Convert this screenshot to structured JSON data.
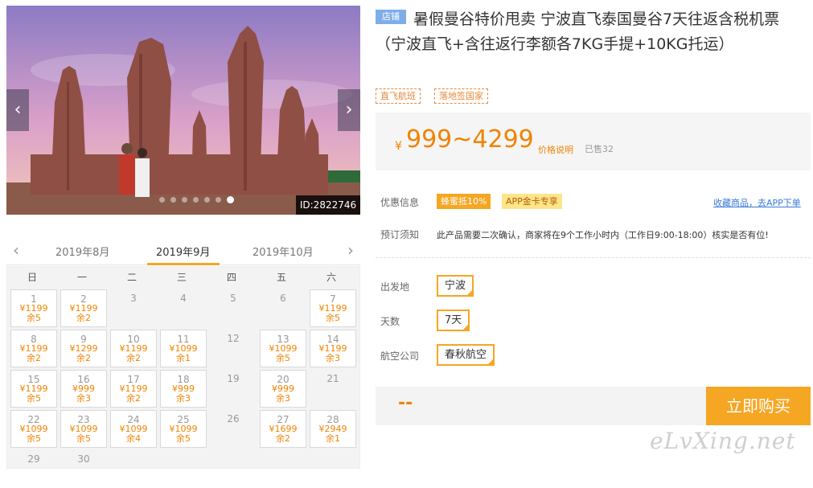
{
  "gallery": {
    "prev_icon": "‹",
    "next_icon": "›",
    "id_label": "ID:2822746"
  },
  "calendar": {
    "prev_month": "2019年8月",
    "current_month": "2019年9月",
    "next_month": "2019年10月",
    "weekdays": [
      "日",
      "一",
      "二",
      "三",
      "四",
      "五",
      "六"
    ],
    "days": [
      {
        "day": "1",
        "price": "¥1199",
        "stock": "余5"
      },
      {
        "day": "2",
        "price": "¥1199",
        "stock": "余2"
      },
      {
        "day": "3",
        "price": "",
        "stock": ""
      },
      {
        "day": "4",
        "price": "",
        "stock": ""
      },
      {
        "day": "5",
        "price": "",
        "stock": ""
      },
      {
        "day": "6",
        "price": "",
        "stock": ""
      },
      {
        "day": "7",
        "price": "¥1199",
        "stock": "余5"
      },
      {
        "day": "8",
        "price": "¥1199",
        "stock": "余2"
      },
      {
        "day": "9",
        "price": "¥1299",
        "stock": "余2"
      },
      {
        "day": "10",
        "price": "¥1199",
        "stock": "余2"
      },
      {
        "day": "11",
        "price": "¥1099",
        "stock": "余1"
      },
      {
        "day": "12",
        "price": "",
        "stock": ""
      },
      {
        "day": "13",
        "price": "¥1099",
        "stock": "余5"
      },
      {
        "day": "14",
        "price": "¥1199",
        "stock": "余3"
      },
      {
        "day": "15",
        "price": "¥1199",
        "stock": "余5"
      },
      {
        "day": "16",
        "price": "¥999",
        "stock": "余3"
      },
      {
        "day": "17",
        "price": "¥1199",
        "stock": "余2"
      },
      {
        "day": "18",
        "price": "¥999",
        "stock": "余3"
      },
      {
        "day": "19",
        "price": "",
        "stock": ""
      },
      {
        "day": "20",
        "price": "¥999",
        "stock": "余3"
      },
      {
        "day": "21",
        "price": "",
        "stock": ""
      },
      {
        "day": "22",
        "price": "¥1099",
        "stock": "余5"
      },
      {
        "day": "23",
        "price": "¥1099",
        "stock": "余5"
      },
      {
        "day": "24",
        "price": "¥1099",
        "stock": "余4"
      },
      {
        "day": "25",
        "price": "¥1099",
        "stock": "余5"
      },
      {
        "day": "26",
        "price": "",
        "stock": ""
      },
      {
        "day": "27",
        "price": "¥1699",
        "stock": "余2"
      },
      {
        "day": "28",
        "price": "¥2949",
        "stock": "余1"
      },
      {
        "day": "29",
        "price": "",
        "stock": ""
      },
      {
        "day": "30",
        "price": "",
        "stock": ""
      }
    ]
  },
  "product": {
    "store_tag": "店铺",
    "title": "暑假曼谷特价甩卖 宁波直飞泰国曼谷7天往返含税机票（宁波直飞+含往返行李额各7KG手提+10KG托运）",
    "features": [
      "直飞航班",
      "落地签国家"
    ]
  },
  "price": {
    "currency": "¥",
    "value": "999~4299",
    "explain_link": "价格说明",
    "sold": "已售32"
  },
  "promo": {
    "label": "优惠信息",
    "tag1": "蜂蜜抵10%",
    "tag2": "APP金卡专享",
    "fav_link": "收藏商品，去APP下单"
  },
  "notice": {
    "label": "预订须知",
    "text": "此产品需要二次确认，商家将在9个工作小时内（工作日9:00-18:00）核实是否有位!"
  },
  "options": {
    "departure_label": "出发地",
    "departure_value": "宁波",
    "days_label": "天数",
    "days_value": "7天",
    "airline_label": "航空公司",
    "airline_value": "春秋航空"
  },
  "buy": {
    "total": "--",
    "button": "立即购买"
  },
  "watermark": "eLvXing.net"
}
